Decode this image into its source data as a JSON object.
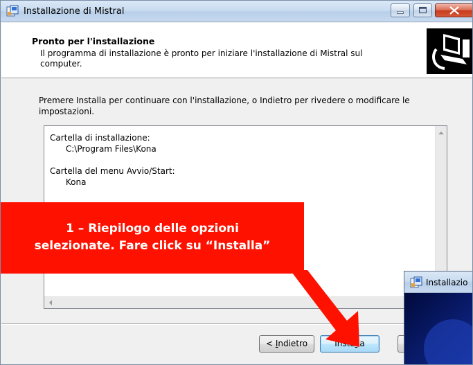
{
  "window": {
    "title": "Installazione di Mistral"
  },
  "header": {
    "title": "Pronto per l'installazione",
    "description": "Il programma di installazione è pronto per iniziare l'installazione di Mistral sul computer."
  },
  "body": {
    "instructions": "Premere Installa per continuare con l'installazione, o Indietro per rivedere o modificare le impostazioni.",
    "memo_lines": [
      "Cartella di installazione:",
      "      C:\\Program Files\\Kona",
      "",
      "Cartella del menu Avvio/Start:",
      "      Kona"
    ]
  },
  "buttons": {
    "back": {
      "prefix": "< ",
      "underlined": "I",
      "rest": "ndietro"
    },
    "install": {
      "prefix": "Insta",
      "underlined": "l",
      "rest": "la"
    },
    "cancel": ""
  },
  "second_window": {
    "title": "Installazio"
  },
  "callout": {
    "line1": "1 – Riepilogo delle opzioni",
    "line2": "selezionate. Fare click su “Installa”",
    "color": "#ff1100"
  },
  "icons": [
    "app-icon",
    "minimize-icon",
    "maximize-icon",
    "close-icon",
    "installer-computer-icon",
    "scroll-up-arrow-icon",
    "scroll-left-arrow-icon"
  ]
}
